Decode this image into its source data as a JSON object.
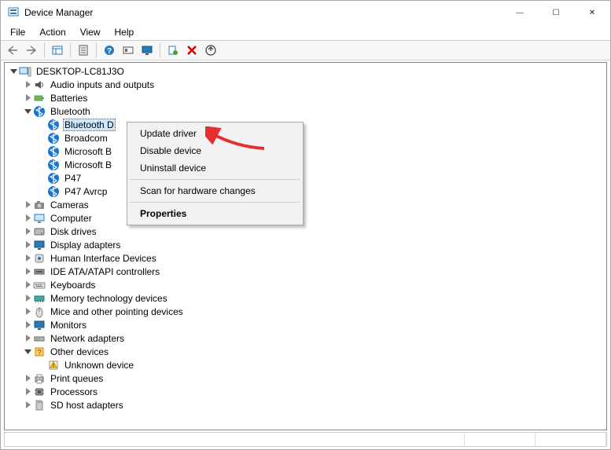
{
  "window": {
    "title": "Device Manager",
    "controls": {
      "minimize": "—",
      "maximize": "☐",
      "close": "✕"
    }
  },
  "menubar": [
    "File",
    "Action",
    "View",
    "Help"
  ],
  "toolbar_icons": [
    "back",
    "forward",
    "sep",
    "show-hidden",
    "sep",
    "properties",
    "sep",
    "help",
    "toggle",
    "monitor",
    "sep",
    "scan",
    "delete",
    "update"
  ],
  "root": {
    "label": "DESKTOP-LC81J3O",
    "expanded": true,
    "children": [
      {
        "label": "Audio inputs and outputs",
        "icon": "audio",
        "expandable": true
      },
      {
        "label": "Batteries",
        "icon": "battery",
        "expandable": true
      },
      {
        "label": "Bluetooth",
        "icon": "bluetooth",
        "expandable": true,
        "expanded": true,
        "children": [
          {
            "label": "Bluetooth D",
            "icon": "bluetooth",
            "selected": true
          },
          {
            "label": "Broadcom",
            "icon": "bluetooth"
          },
          {
            "label": "Microsoft B",
            "icon": "bluetooth"
          },
          {
            "label": "Microsoft B",
            "icon": "bluetooth"
          },
          {
            "label": "P47",
            "icon": "bluetooth"
          },
          {
            "label": "P47 Avrcp",
            "icon": "bluetooth"
          }
        ]
      },
      {
        "label": "Cameras",
        "icon": "camera",
        "expandable": true
      },
      {
        "label": "Computer",
        "icon": "computer",
        "expandable": true
      },
      {
        "label": "Disk drives",
        "icon": "disk",
        "expandable": true
      },
      {
        "label": "Display adapters",
        "icon": "display",
        "expandable": true
      },
      {
        "label": "Human Interface Devices",
        "icon": "hid",
        "expandable": true
      },
      {
        "label": "IDE ATA/ATAPI controllers",
        "icon": "ide",
        "expandable": true
      },
      {
        "label": "Keyboards",
        "icon": "keyboard",
        "expandable": true
      },
      {
        "label": "Memory technology devices",
        "icon": "memory",
        "expandable": true
      },
      {
        "label": "Mice and other pointing devices",
        "icon": "mouse",
        "expandable": true
      },
      {
        "label": "Monitors",
        "icon": "monitor",
        "expandable": true
      },
      {
        "label": "Network adapters",
        "icon": "network",
        "expandable": true
      },
      {
        "label": "Other devices",
        "icon": "other",
        "expandable": true,
        "expanded": true,
        "children": [
          {
            "label": "Unknown device",
            "icon": "warning"
          }
        ]
      },
      {
        "label": "Print queues",
        "icon": "printer",
        "expandable": true
      },
      {
        "label": "Processors",
        "icon": "cpu",
        "expandable": true
      },
      {
        "label": "SD host adapters",
        "icon": "sd",
        "expandable": true
      }
    ]
  },
  "context_menu": {
    "items": [
      {
        "label": "Update driver"
      },
      {
        "label": "Disable device"
      },
      {
        "label": "Uninstall device"
      },
      {
        "sep": true
      },
      {
        "label": "Scan for hardware changes"
      },
      {
        "sep": true
      },
      {
        "label": "Properties",
        "bold": true
      }
    ]
  }
}
